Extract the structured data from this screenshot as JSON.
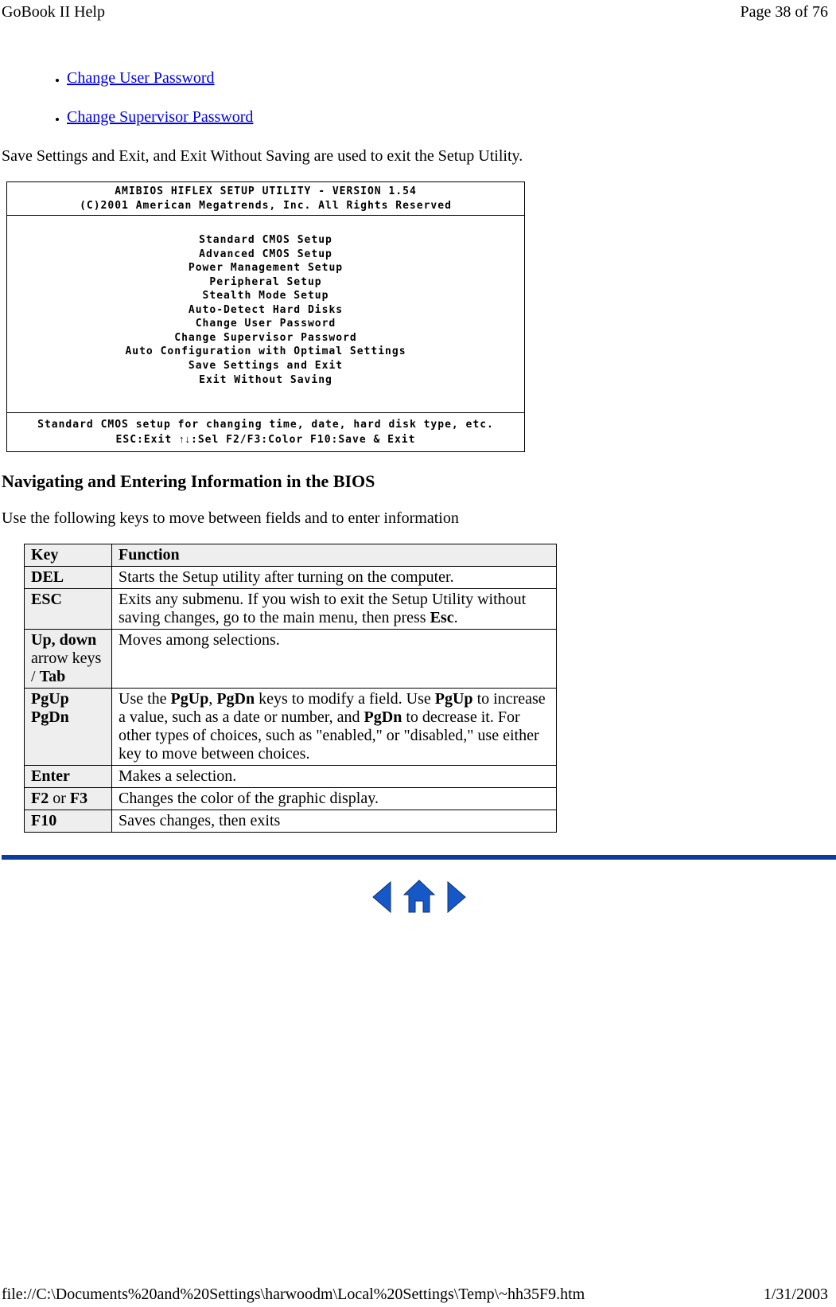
{
  "header": {
    "title": "GoBook II Help",
    "page": "Page 38 of 76"
  },
  "links": {
    "change_user": "Change User Password",
    "change_supervisor": "Change Supervisor Password"
  },
  "para1": "Save Settings and Exit, and Exit Without Saving are used to exit the Setup Utility.",
  "bios": {
    "title1": "AMIBIOS HIFLEX SETUP UTILITY - VERSION 1.54",
    "title2": "(C)2001 American Megatrends, Inc. All Rights Reserved",
    "menu": [
      "Standard CMOS Setup",
      "Advanced CMOS Setup",
      "Power Management Setup",
      "Peripheral Setup",
      "Stealth Mode Setup",
      "Auto-Detect Hard Disks",
      "Change User Password",
      "Change Supervisor Password",
      "Auto Configuration with Optimal Settings",
      "Save Settings and Exit",
      "Exit Without Saving"
    ],
    "footer1": "Standard CMOS setup for changing time, date, hard disk type, etc.",
    "footer2_a": "ESC:Exit  ",
    "footer2_b": ":Sel  F2/F3:Color  F10:Save & Exit"
  },
  "heading": "Navigating and Entering Information in the BIOS",
  "para2": "Use the following keys to move between fields and to enter information",
  "table": {
    "header_key": "Key",
    "header_func": "Function",
    "rows": [
      {
        "key_html": "<b>DEL</b>",
        "func_html": "Starts the Setup utility after turning on the computer."
      },
      {
        "key_html": "<b>ESC</b>",
        "func_html": "Exits any submenu.  If you wish to exit the Setup Utility without saving changes, go to the main menu, then press <b>Esc</b>."
      },
      {
        "key_html": "<b>Up</b>, <b>down</b> <span class=\"normal-weight\">arrow keys /</span> <b>Tab</b>",
        "func_html": "Moves among selections."
      },
      {
        "key_html": "<b>PgUp PgDn</b>",
        "func_html": "Use the <b>PgUp</b>, <b>PgDn</b> keys to modify a field.  Use <b>PgUp</b> to increase a value, such as a date or number, and <b>PgDn</b> to decrease it.  For other types of choices, such as \"enabled,\" or \"disabled,\" use either key to move between choices."
      },
      {
        "key_html": "<b>Enter</b>",
        "func_html": "Makes a selection."
      },
      {
        "key_html": "<b>F2</b> <span class=\"normal-weight\">or</span> <b>F3</b>",
        "func_html": "Changes the color of the graphic display."
      },
      {
        "key_html": "<b>F10</b>",
        "func_html": "Saves changes, then exits"
      }
    ]
  },
  "footer": {
    "path": "file://C:\\Documents%20and%20Settings\\harwoodm\\Local%20Settings\\Temp\\~hh35F9.htm",
    "date": "1/31/2003"
  }
}
